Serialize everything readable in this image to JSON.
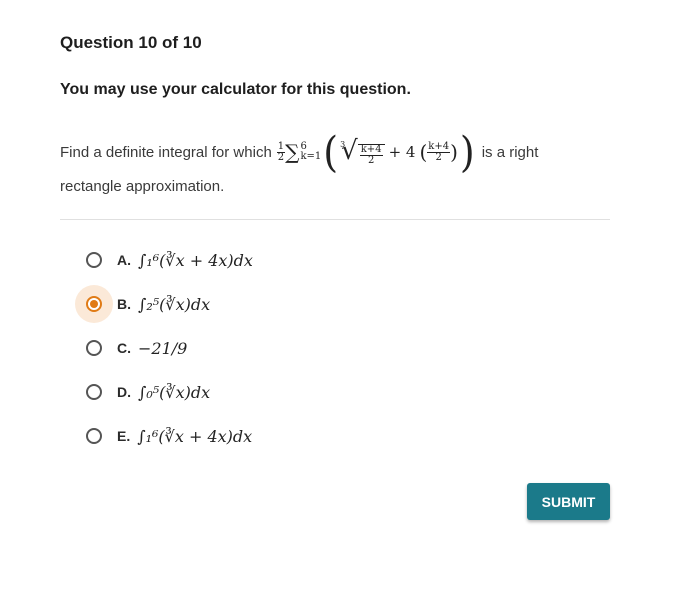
{
  "question": {
    "title": "Question 10 of 10",
    "note": "You may use your calculator for this question.",
    "text_before": "Find a definite integral for which",
    "text_after": "is a right",
    "text_line2": "rectangle approximation.",
    "expression": {
      "coef_num": "1",
      "coef_den": "2",
      "sigma": "∑",
      "upper": "6",
      "lower": "k=1",
      "root_index": "3",
      "inner_num": "k+4",
      "inner_den": "2",
      "plus_four": "+ 4",
      "paren_num": "k+4",
      "paren_den": "2"
    }
  },
  "options": [
    {
      "letter": "A.",
      "math": "∫₁⁶(∛x + 4x)dx",
      "selected": false
    },
    {
      "letter": "B.",
      "math": "∫₂⁵(∛x)dx",
      "selected": true
    },
    {
      "letter": "C.",
      "math": "−21/9",
      "selected": false
    },
    {
      "letter": "D.",
      "math": "∫₀⁵(∛x)dx",
      "selected": false
    },
    {
      "letter": "E.",
      "math": "∫₁⁶(∛x + 4x)dx",
      "selected": false
    }
  ],
  "submit_label": "SUBMIT",
  "colors": {
    "accent": "#e07b16",
    "accent_bg": "#fbe9d8",
    "button": "#1b7a8a"
  }
}
